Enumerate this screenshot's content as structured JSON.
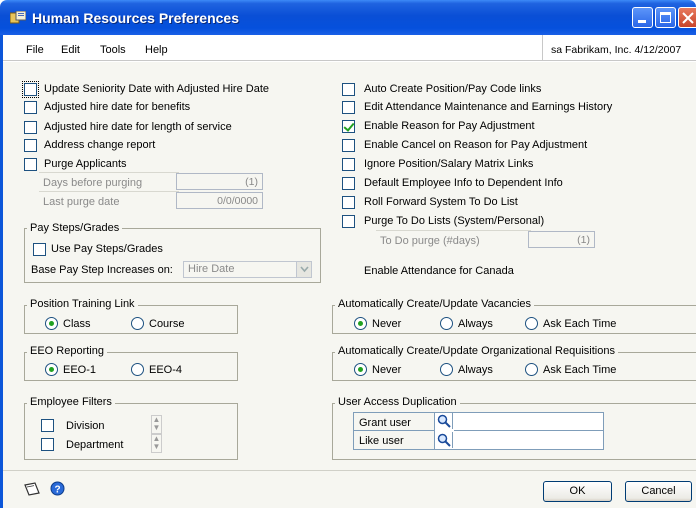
{
  "window": {
    "title": "Human Resources Preferences"
  },
  "menu": {
    "file": "File",
    "edit": "Edit",
    "tools": "Tools",
    "help": "Help"
  },
  "session": {
    "info": "sa  Fabrikam, Inc.  4/12/2007"
  },
  "left_options": [
    {
      "label": "Update Seniority Date with Adjusted Hire Date",
      "checked": false
    },
    {
      "label": "Adjusted hire date for benefits",
      "checked": false
    },
    {
      "label": "Adjusted hire date for length of service",
      "checked": false
    },
    {
      "label": "Address change report",
      "checked": false
    },
    {
      "label": "Purge Applicants",
      "checked": false
    }
  ],
  "purge": {
    "days_label": "Days before purging",
    "days_value": "(1)",
    "last_label": "Last purge date",
    "last_value": "0/0/0000"
  },
  "pay_steps": {
    "title": "Pay Steps/Grades",
    "use_label": "Use Pay Steps/Grades",
    "base_label": "Base Pay Step Increases on:",
    "base_value": "Hire Date"
  },
  "position_training": {
    "title": "Position Training Link",
    "class": "Class",
    "course": "Course"
  },
  "eeo": {
    "title": "EEO Reporting",
    "eeo1": "EEO-1",
    "eeo4": "EEO-4"
  },
  "filters": {
    "title": "Employee Filters",
    "division": "Division",
    "department": "Department"
  },
  "right_options": [
    {
      "label": "Auto Create Position/Pay Code links",
      "checked": false
    },
    {
      "label": "Edit Attendance Maintenance and Earnings History",
      "checked": false
    },
    {
      "label": "Enable Reason for Pay Adjustment",
      "checked": true
    },
    {
      "label": "Enable Cancel on Reason for Pay Adjustment",
      "checked": false
    },
    {
      "label": "Ignore Position/Salary Matrix Links",
      "checked": false
    },
    {
      "label": "Default Employee Info to Dependent Info",
      "checked": false
    },
    {
      "label": "Roll Forward System To Do List",
      "checked": false
    },
    {
      "label": "Purge To Do Lists (System/Personal)",
      "checked": false
    }
  ],
  "todo_purge": {
    "label": "To Do purge (#days)",
    "value": "(1)"
  },
  "attendance_canada": "Enable Attendance for Canada",
  "vacancies": {
    "title": "Automatically Create/Update Vacancies",
    "never": "Never",
    "always": "Always",
    "ask": "Ask Each Time"
  },
  "requisitions": {
    "title": "Automatically Create/Update Organizational Requisitions",
    "never": "Never",
    "always": "Always",
    "ask": "Ask Each Time"
  },
  "user_access": {
    "title": "User Access Duplication",
    "grant": "Grant user",
    "like": "Like user"
  },
  "buttons": {
    "ok": "OK",
    "cancel": "Cancel"
  },
  "colors": {
    "title_bar": "#0550dc",
    "check": "#21a121",
    "background": "#f6f6f1"
  }
}
